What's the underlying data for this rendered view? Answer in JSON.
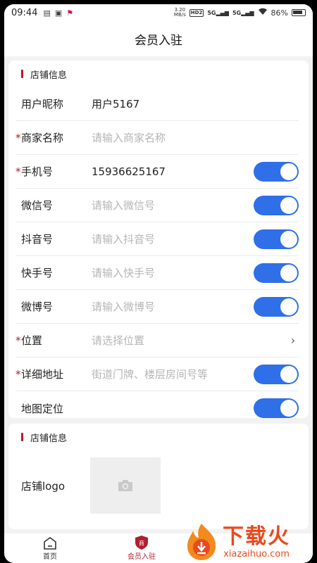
{
  "status_bar": {
    "time": "09:44",
    "net_speed_value": "3.20",
    "net_speed_unit": "MB/s",
    "hd_badge": "HD2",
    "signal1": "5G",
    "signal2": "5G",
    "battery": "86%"
  },
  "header": {
    "title": "会员入驻"
  },
  "section1": {
    "title": "店铺信息",
    "fields": [
      {
        "label": "用户昵称",
        "value": "用户5167",
        "placeholder": "",
        "required": false,
        "control": "none"
      },
      {
        "label": "商家名称",
        "value": "",
        "placeholder": "请输入商家名称",
        "required": true,
        "control": "none"
      },
      {
        "label": "手机号",
        "value": "15936625167",
        "placeholder": "",
        "required": true,
        "control": "toggle-on"
      },
      {
        "label": "微信号",
        "value": "",
        "placeholder": "请输入微信号",
        "required": false,
        "control": "toggle-on"
      },
      {
        "label": "抖音号",
        "value": "",
        "placeholder": "请输入抖音号",
        "required": false,
        "control": "toggle-on"
      },
      {
        "label": "快手号",
        "value": "",
        "placeholder": "请输入快手号",
        "required": false,
        "control": "toggle-on"
      },
      {
        "label": "微博号",
        "value": "",
        "placeholder": "请输入微博号",
        "required": false,
        "control": "toggle-on"
      },
      {
        "label": "位置",
        "value": "",
        "placeholder": "请选择位置",
        "required": true,
        "control": "chevron"
      },
      {
        "label": "详细地址",
        "value": "",
        "placeholder": "街道门牌、楼层房间号等",
        "required": true,
        "control": "toggle-on"
      },
      {
        "label": "地图定位",
        "value": "",
        "placeholder": "",
        "required": false,
        "control": "toggle-on"
      }
    ]
  },
  "section2": {
    "title": "店铺信息",
    "logo_label": "店铺logo"
  },
  "tab_bar": {
    "tabs": [
      {
        "label": "首页",
        "icon": "home-icon",
        "active": false
      },
      {
        "label": "会员入驻",
        "icon": "shield-merchant-icon",
        "active": true,
        "icon_text": "商"
      }
    ]
  },
  "watermark": {
    "text": "下载火",
    "url_text": "xiazaihuo.com"
  },
  "colors": {
    "accent": "#b01e2e",
    "toggle": "#2f6fe8",
    "watermark": "#e8491d"
  }
}
